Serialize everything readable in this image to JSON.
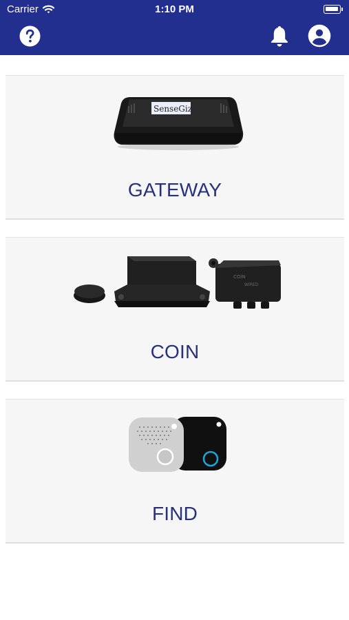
{
  "status_bar": {
    "carrier": "Carrier",
    "time": "1:10 PM"
  },
  "header": {
    "background": "#232f8f",
    "help_icon": "question-circle-icon",
    "notifications_icon": "bell-icon",
    "profile_icon": "user-circle-icon"
  },
  "cards": [
    {
      "label": "GATEWAY",
      "image": "gateway-device-image"
    },
    {
      "label": "COIN",
      "image": "coin-devices-image"
    },
    {
      "label": "FIND",
      "image": "find-tags-image"
    }
  ],
  "colors": {
    "accent": "#232f8f",
    "card_text": "#27317b",
    "card_background": "#f6f6f6"
  }
}
